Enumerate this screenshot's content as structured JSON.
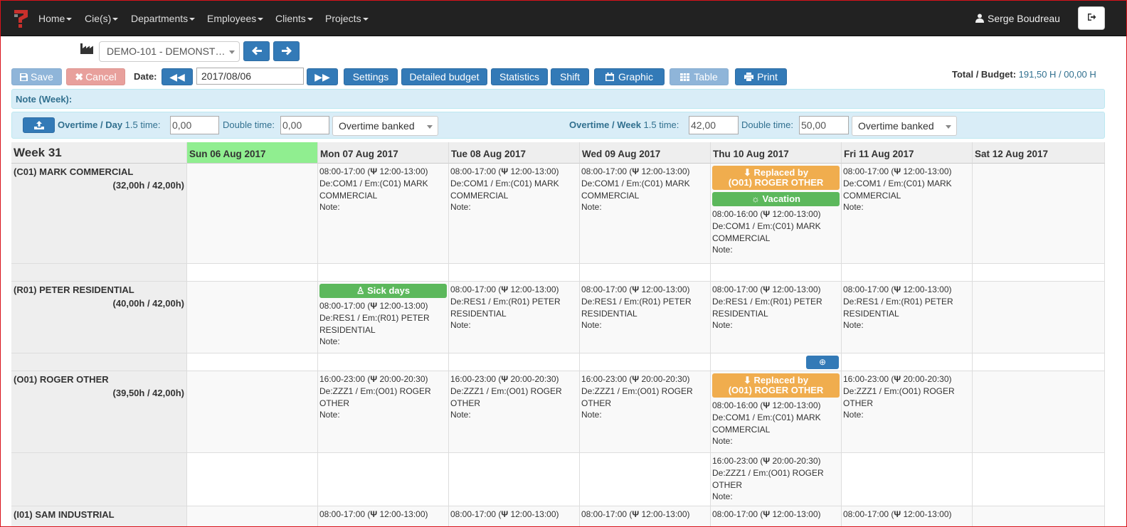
{
  "nav": {
    "menu": [
      "Home",
      "Cie(s)",
      "Departments",
      "Employees",
      "Clients",
      "Projects"
    ],
    "user": "Serge Boudreau"
  },
  "company": {
    "selected": "DEMO-101 - DEMONST…"
  },
  "toolbar": {
    "save": "Save",
    "cancel": "Cancel",
    "date_label": "Date:",
    "date_value": "2017/08/06",
    "settings": "Settings",
    "detailed_budget": "Detailed budget",
    "statistics": "Statistics",
    "shift": "Shift",
    "graphic": "Graphic",
    "table": "Table",
    "print": "Print",
    "total_label": "Total / Budget:",
    "total_value": "191,50 H / 00,00 H"
  },
  "note": {
    "label": "Note (Week):"
  },
  "overtime": {
    "day_label": "Overtime / Day",
    "week_label": "Overtime / Week",
    "time15_label": "1.5 time:",
    "double_label": "Double time:",
    "day_15": "0,00",
    "day_double": "0,00",
    "week_15": "42,00",
    "week_double": "50,00",
    "banked": "Overtime banked"
  },
  "week": {
    "title": "Week 31",
    "days": [
      "Sun 06 Aug 2017",
      "Mon 07 Aug 2017",
      "Tue 08 Aug 2017",
      "Wed 09 Aug 2017",
      "Thu 10 Aug 2017",
      "Fri 11 Aug 2017",
      "Sat 12 Aug 2017"
    ],
    "today_color": "#90ee90"
  },
  "badges": {
    "replaced_line1": "Replaced by",
    "replaced_line2": "(O01) ROGER OTHER",
    "vacation": "Vacation",
    "sick": "Sick days"
  },
  "employees": {
    "e0": {
      "name": "(C01) MARK COMMERCIAL",
      "hours": "(32,00h / 42,00h)"
    },
    "e1": {
      "name": "(R01) PETER RESIDENTIAL",
      "hours": "(40,00h / 42,00h)"
    },
    "e2": {
      "name": "(O01) ROGER OTHER",
      "hours": "(39,50h / 42,00h)"
    },
    "e3": {
      "name": "(I01) SAM INDUSTRIAL"
    }
  },
  "shifts": {
    "mark_day": {
      "time": "08:00-17:00 (",
      "meal": "12:00-13:00)",
      "de": "De:COM1 / Em:(C01) MARK COMMERCIAL",
      "note": "Note:"
    },
    "mark_thu": {
      "time": "08:00-16:00 (",
      "meal": "12:00-13:00)",
      "de": "De:COM1 / Em:(C01) MARK COMMERCIAL",
      "note": "Note:"
    },
    "peter": {
      "time": "08:00-17:00 (",
      "meal": "12:00-13:00)",
      "de": "De:RES1 / Em:(R01) PETER RESIDENTIAL",
      "note": "Note:"
    },
    "roger": {
      "time": "16:00-23:00 (",
      "meal": "20:00-20:30)",
      "de": "De:ZZZ1 / Em:(O01) ROGER OTHER",
      "note": "Note:"
    },
    "sam": {
      "time": "08:00-17:00 (",
      "meal": "12:00-13:00)"
    }
  }
}
